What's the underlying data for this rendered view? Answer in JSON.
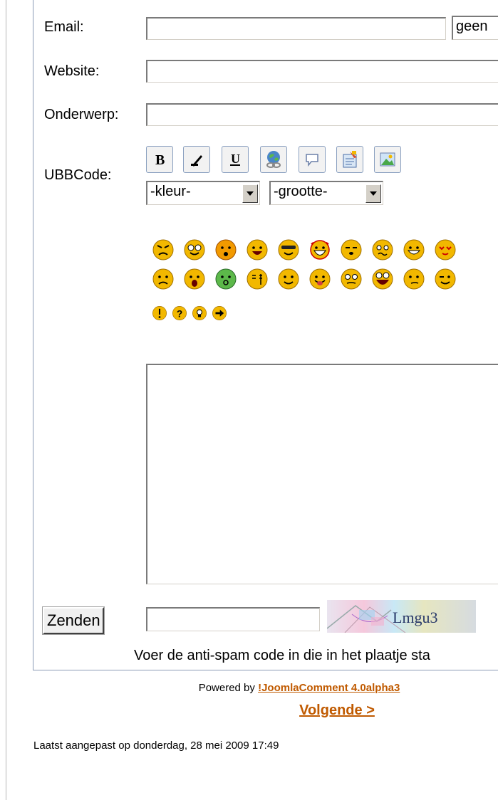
{
  "form": {
    "labels": {
      "email": "Email:",
      "website": "Website:",
      "subject": "Onderwerp:",
      "ubbcode": "UBBCode:"
    },
    "email_value": "",
    "email_visibility_select": "geen",
    "website_value": "",
    "subject_value": "",
    "ubb_buttons": [
      "bold-icon",
      "italic-icon",
      "underline-icon",
      "link-icon",
      "quote-icon",
      "code-icon",
      "image-icon"
    ],
    "color_select": "-kleur-",
    "size_select": "-grootte-",
    "smileys": [
      "angry",
      "nerd",
      "surprised",
      "happy",
      "cool",
      "devil",
      "sleepy",
      "confused",
      "grin",
      "love",
      "sad",
      "shocked",
      "sick",
      "blank",
      "smile",
      "tongue",
      "dizzy",
      "laugh",
      "wondering",
      "wink"
    ],
    "small_icons": [
      "exclamation",
      "question",
      "idea",
      "arrow"
    ],
    "comment_value": "",
    "submit_label": "Zenden",
    "captcha_value": "",
    "captcha_text": "Lmgu3",
    "captcha_hint": "Voer de anti-spam code in die in het plaatje sta"
  },
  "footer": {
    "powered_prefix": "Powered by ",
    "powered_link": "!JoomlaComment 4.0alpha3",
    "next_link": "Volgende >",
    "last_modified": "Laatst aangepast op donderdag, 28 mei 2009 17:49"
  },
  "colors": {
    "link": "#c05a00",
    "smiley": "#f2b800",
    "border": "#8a9bb5"
  }
}
